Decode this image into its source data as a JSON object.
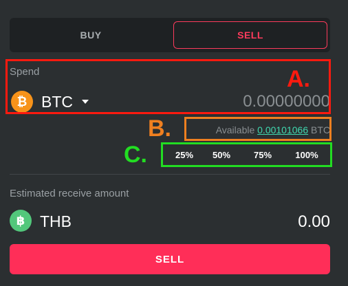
{
  "colors": {
    "background": "#2b2f31",
    "accent": "#ff2e58",
    "available_link": "#40d9b0",
    "annotation_a": "#ff1a0f",
    "annotation_b": "#f08020",
    "annotation_c": "#22dd22"
  },
  "tabs": {
    "buy_label": "BUY",
    "sell_label": "SELL",
    "active": "SELL"
  },
  "spend": {
    "label": "Spend",
    "currency": "BTC",
    "currency_icon": "bitcoin-icon",
    "amount": "0.00000000"
  },
  "available": {
    "prefix": "Available",
    "value": "0.00101066",
    "unit": "BTC"
  },
  "percent_buttons": [
    "25%",
    "50%",
    "75%",
    "100%"
  ],
  "annotations": {
    "a": "A.",
    "b": "B.",
    "c": "C."
  },
  "receive": {
    "label": "Estimated receive amount",
    "currency": "THB",
    "currency_icon": "baht-icon",
    "amount": "0.00"
  },
  "action": {
    "sell_button_label": "SELL"
  }
}
